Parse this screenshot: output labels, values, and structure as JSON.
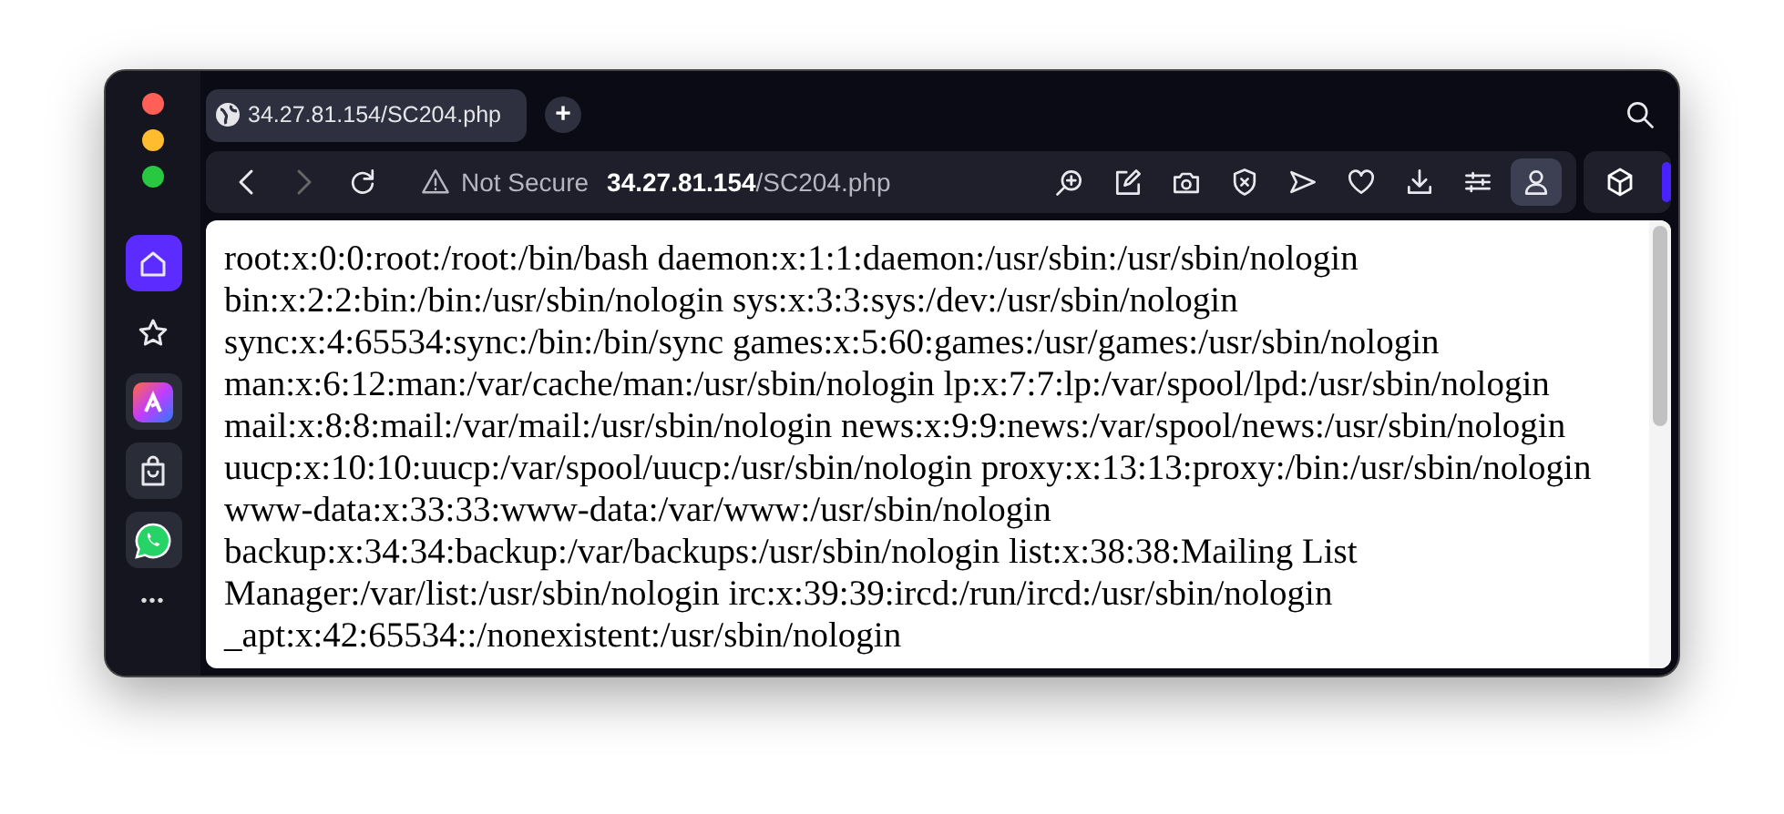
{
  "tabs": [
    {
      "label": "34.27.81.154/SC204.php",
      "selected": true
    }
  ],
  "new_tab": "+",
  "address_bar": {
    "security": "Not Secure",
    "host": "34.27.81.154",
    "path": "/SC204.php"
  },
  "sidebar": {
    "items": [
      {
        "kind": "home",
        "selected": true
      },
      {
        "kind": "star",
        "selected": false
      },
      {
        "kind": "app",
        "selected": false
      },
      {
        "kind": "bag",
        "selected": false
      },
      {
        "kind": "chat",
        "selected": false
      }
    ],
    "more": "•••"
  },
  "page": {
    "lines": [
      "root:x:0:0:root:/root:/bin/bash daemon:x:1:1:daemon:/usr/sbin:/usr/sbin/nologin",
      "bin:x:2:2:bin:/bin:/usr/sbin/nologin sys:x:3:3:sys:/dev:/usr/sbin/nologin",
      "sync:x:4:65534:sync:/bin:/bin/sync games:x:5:60:games:/usr/games:/usr/sbin/nologin",
      "man:x:6:12:man:/var/cache/man:/usr/sbin/nologin lp:x:7:7:lp:/var/spool/lpd:/usr/sbin/nologin",
      "mail:x:8:8:mail:/var/mail:/usr/sbin/nologin news:x:9:9:news:/var/spool/news:/usr/sbin/nologin",
      "uucp:x:10:10:uucp:/var/spool/uucp:/usr/sbin/nologin proxy:x:13:13:proxy:/bin:/usr/sbin/nologin",
      "www-data:x:33:33:www-data:/var/www:/usr/sbin/nologin",
      "backup:x:34:34:backup:/var/backups:/usr/sbin/nologin list:x:38:38:Mailing List",
      "Manager:/var/list:/usr/sbin/nologin irc:x:39:39:ircd:/run/ircd:/usr/sbin/nologin",
      "_apt:x:42:65534::/nonexistent:/usr/sbin/nologin"
    ]
  }
}
